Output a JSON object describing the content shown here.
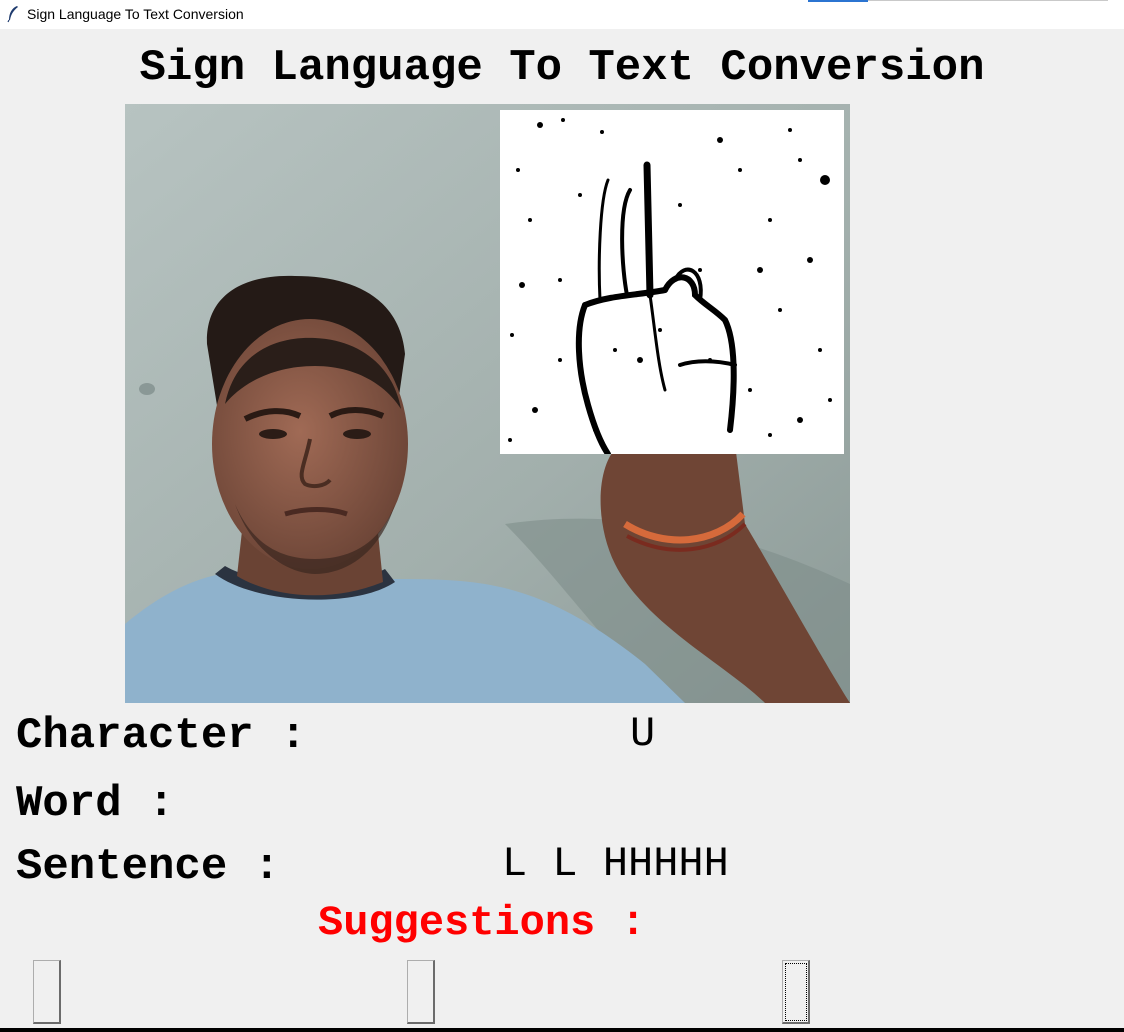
{
  "window": {
    "title": "Sign Language To Text Conversion",
    "icon": "feather-icon"
  },
  "header": {
    "title": "Sign Language To Text Conversion"
  },
  "panels": {
    "camera_feed": "webcam-feed",
    "processed_hand": "binary-hand-image"
  },
  "output": {
    "character_label": "Character :",
    "character_value": "U",
    "word_label": "Word :",
    "word_value": "",
    "sentence_label": "Sentence :",
    "sentence_value": "L L HHHHH",
    "suggestions_label": "Suggestions :"
  },
  "suggestion_buttons": [
    {
      "label": ""
    },
    {
      "label": ""
    },
    {
      "label": ""
    }
  ],
  "colors": {
    "background": "#f0f0f0",
    "suggestions_text": "#ff0000"
  }
}
